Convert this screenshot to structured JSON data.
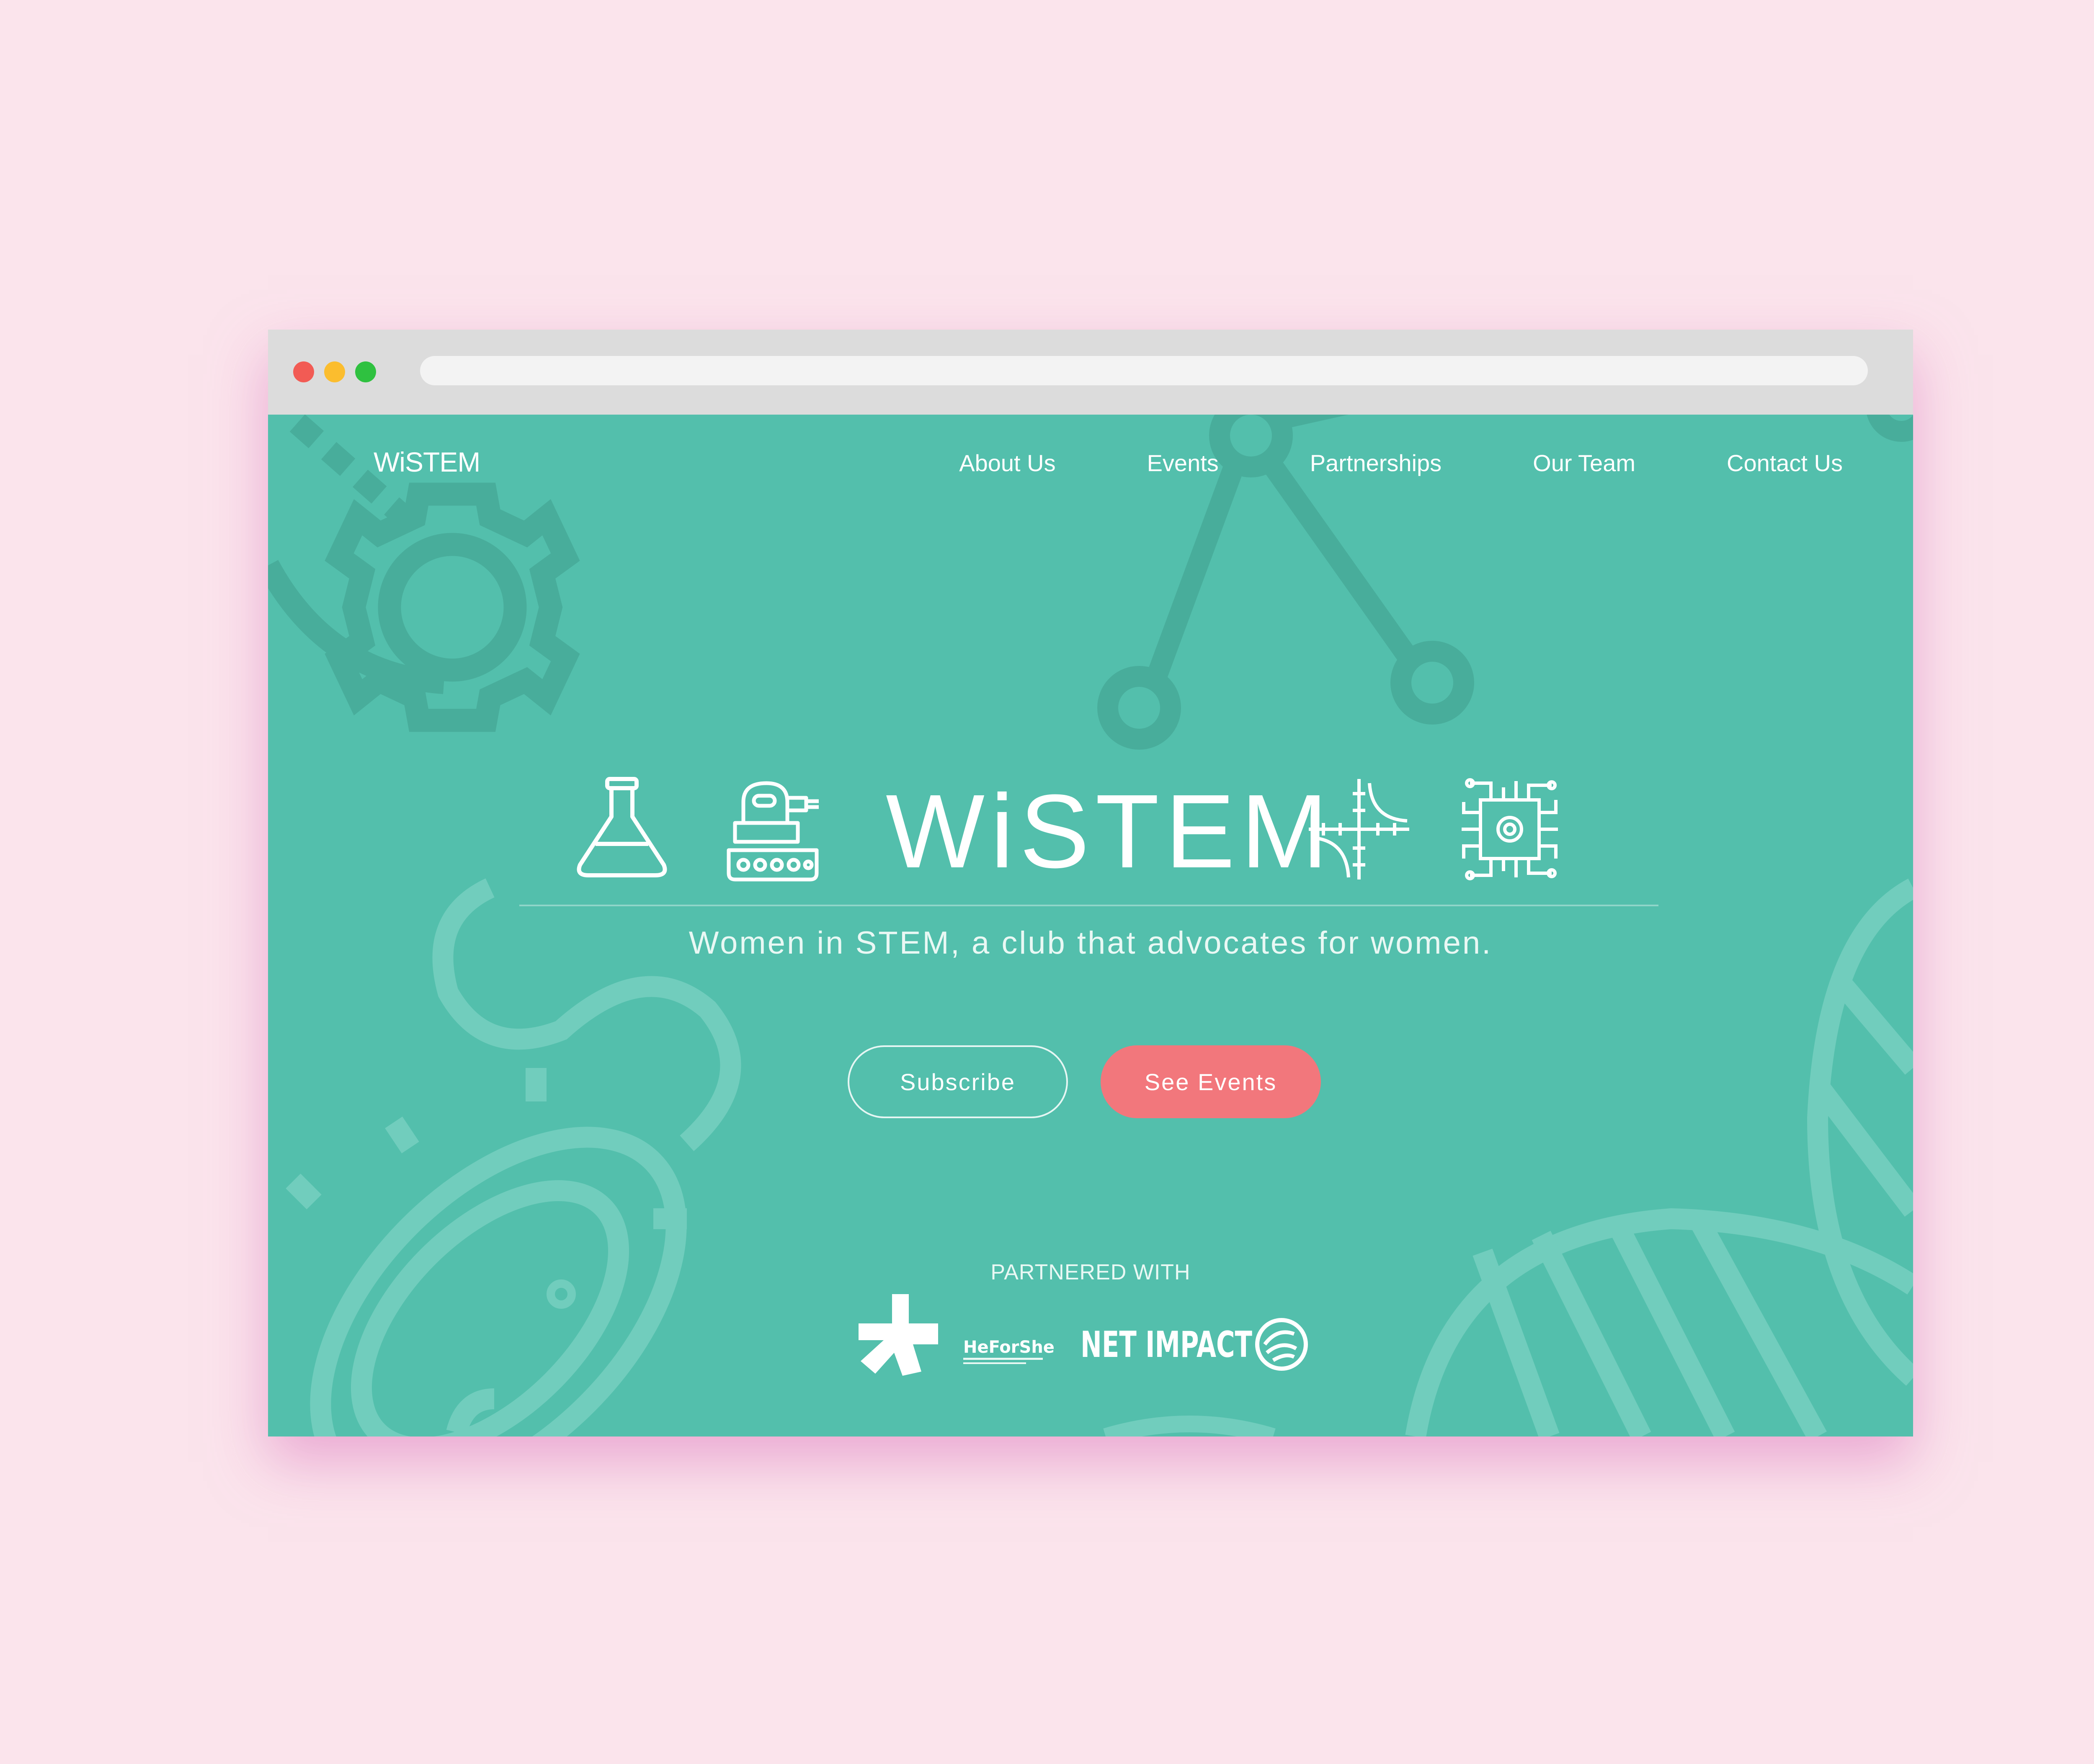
{
  "site": {
    "nav_logo": "WiSTEM",
    "nav_links": [
      "About Us",
      "Events",
      "Partnerships",
      "Our Team",
      "Contact Us"
    ]
  },
  "hero": {
    "title": "WiSTEM",
    "tagline": "Women in STEM, a club that advocates for women.",
    "icons": [
      "flask-icon",
      "robot-icon",
      "graph-icon",
      "circuit-chip-icon"
    ]
  },
  "buttons": {
    "subscribe": "Subscribe",
    "see_events": "See Events"
  },
  "partners": {
    "heading": "PARTNERED WITH",
    "logos": [
      "HeForShe",
      "NET IMPACT"
    ]
  },
  "colors": {
    "page_background": "#fbe4ec",
    "site_background": "#53bfac",
    "accent_button": "#f2777c",
    "text": "#ffffff"
  }
}
